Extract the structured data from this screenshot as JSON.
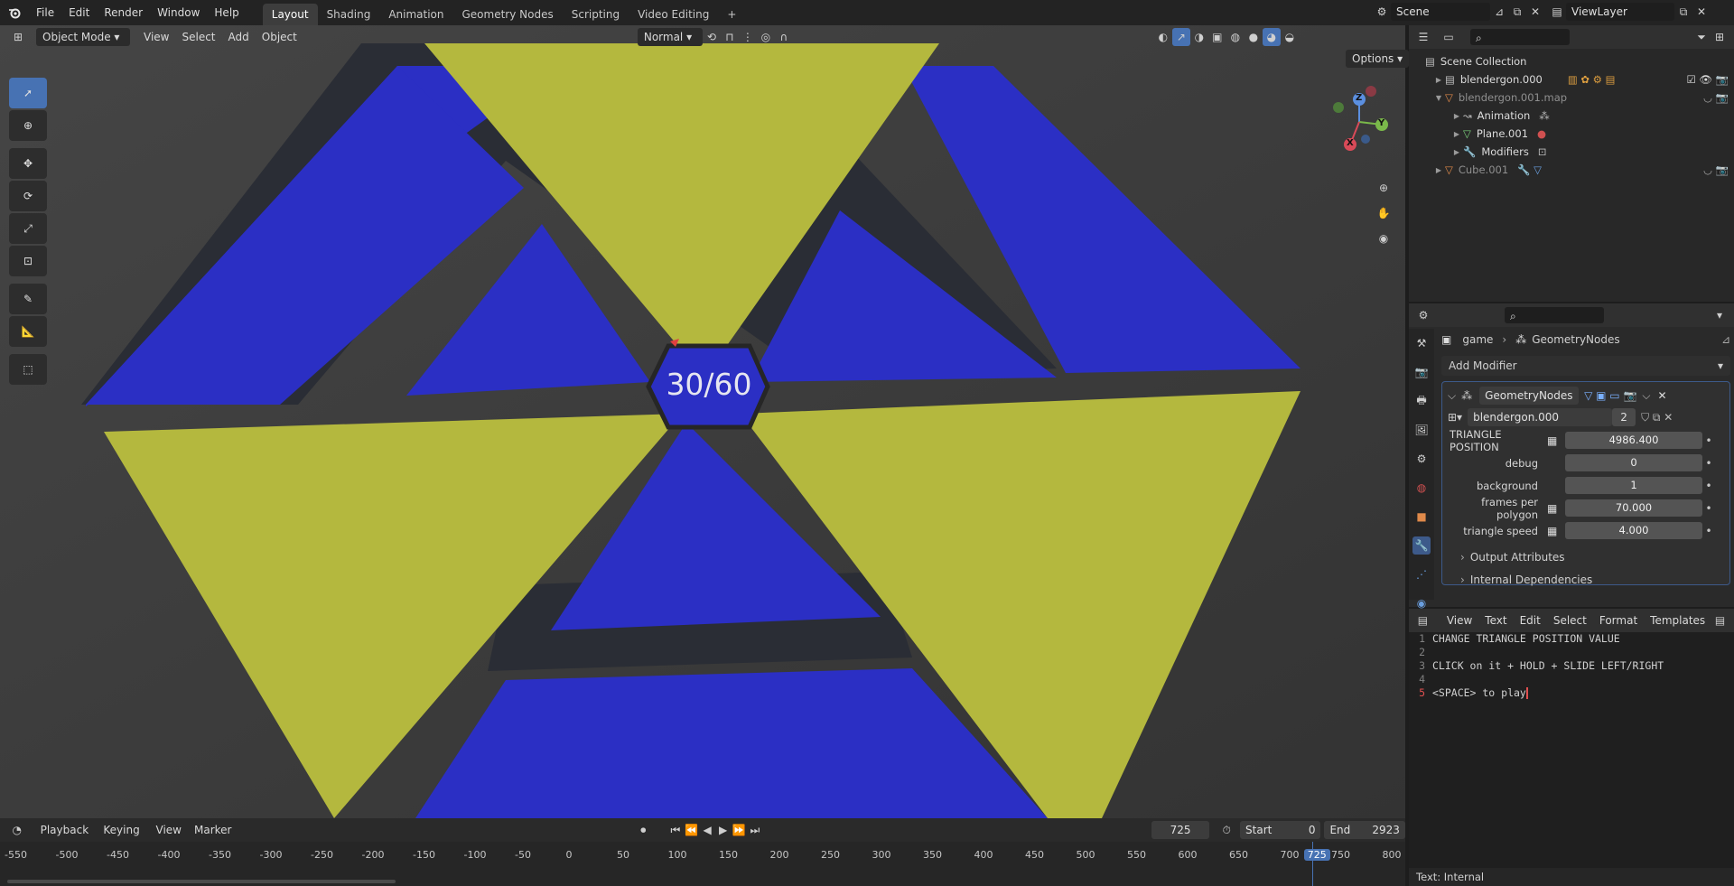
{
  "topbar": {
    "menus": [
      "File",
      "Edit",
      "Render",
      "Window",
      "Help"
    ],
    "workspaces": [
      "Layout",
      "Shading",
      "Animation",
      "Geometry Nodes",
      "Scripting",
      "Video Editing"
    ],
    "active_workspace": "Layout",
    "add_tab": "+",
    "scene": "Scene",
    "view_layer": "ViewLayer"
  },
  "viewport_header": {
    "mode": "Object Mode",
    "menus": [
      "View",
      "Select",
      "Add",
      "Object"
    ],
    "orientation": "Normal",
    "options": "Options"
  },
  "viewport": {
    "counter": "30/60",
    "gizmo": {
      "z": "Z",
      "y": "Y",
      "x": "X"
    },
    "colors": {
      "blue": "#2b2fc4",
      "yellow": "#b4b83e",
      "bg": "#3a3a3a",
      "gap": "#2a2d35"
    }
  },
  "outliner": {
    "search_placeholder": "",
    "rows": [
      {
        "label": "Scene Collection",
        "indent": 0,
        "dim": false
      },
      {
        "label": "blendergon.000",
        "indent": 1,
        "dim": false
      },
      {
        "label": "blendergon.001.map",
        "indent": 1,
        "dim": true
      },
      {
        "label": "Animation",
        "indent": 2,
        "dim": false
      },
      {
        "label": "Plane.001",
        "indent": 2,
        "dim": false
      },
      {
        "label": "Modifiers",
        "indent": 2,
        "dim": false
      },
      {
        "label": "Cube.001",
        "indent": 1,
        "dim": true
      }
    ]
  },
  "properties": {
    "breadcrumb": {
      "object": "game",
      "modifier": "GeometryNodes"
    },
    "add_modifier": "Add Modifier",
    "modifier_name": "GeometryNodes",
    "node_group": "blendergon.000",
    "node_group_users": "2",
    "inputs": [
      {
        "label": "TRIANGLE POSITION",
        "value": "4986.400",
        "icon": true
      },
      {
        "label": "debug",
        "value": "0",
        "icon": false
      },
      {
        "label": "background",
        "value": "1",
        "icon": false
      },
      {
        "label": "frames per polygon",
        "value": "70.000",
        "icon": true
      },
      {
        "label": "triangle speed",
        "value": "4.000",
        "icon": true
      }
    ],
    "panels": [
      "Output Attributes",
      "Internal Dependencies"
    ]
  },
  "text_editor": {
    "menus": [
      "View",
      "Text",
      "Edit",
      "Select",
      "Format",
      "Templates"
    ],
    "lines": [
      {
        "n": "1",
        "text": "CHANGE TRIANGLE POSITION VALUE"
      },
      {
        "n": "2",
        "text": ""
      },
      {
        "n": "3",
        "text": "CLICK on it + HOLD + SLIDE LEFT/RIGHT"
      },
      {
        "n": "4",
        "text": ""
      },
      {
        "n": "5",
        "text": "<SPACE> to play"
      }
    ],
    "status": "Text: Internal"
  },
  "timeline": {
    "menus": [
      "Playback",
      "Keying",
      "View",
      "Marker"
    ],
    "current_frame": "725",
    "start_label": "Start",
    "start": "0",
    "end_label": "End",
    "end": "2923",
    "ticks": [
      "-550",
      "-500",
      "-450",
      "-400",
      "-350",
      "-300",
      "-250",
      "-200",
      "-150",
      "-100",
      "-50",
      "0",
      "50",
      "100",
      "150",
      "200",
      "250",
      "300",
      "350",
      "400",
      "450",
      "500",
      "550",
      "600",
      "650",
      "700",
      "725",
      "750",
      "800"
    ]
  }
}
